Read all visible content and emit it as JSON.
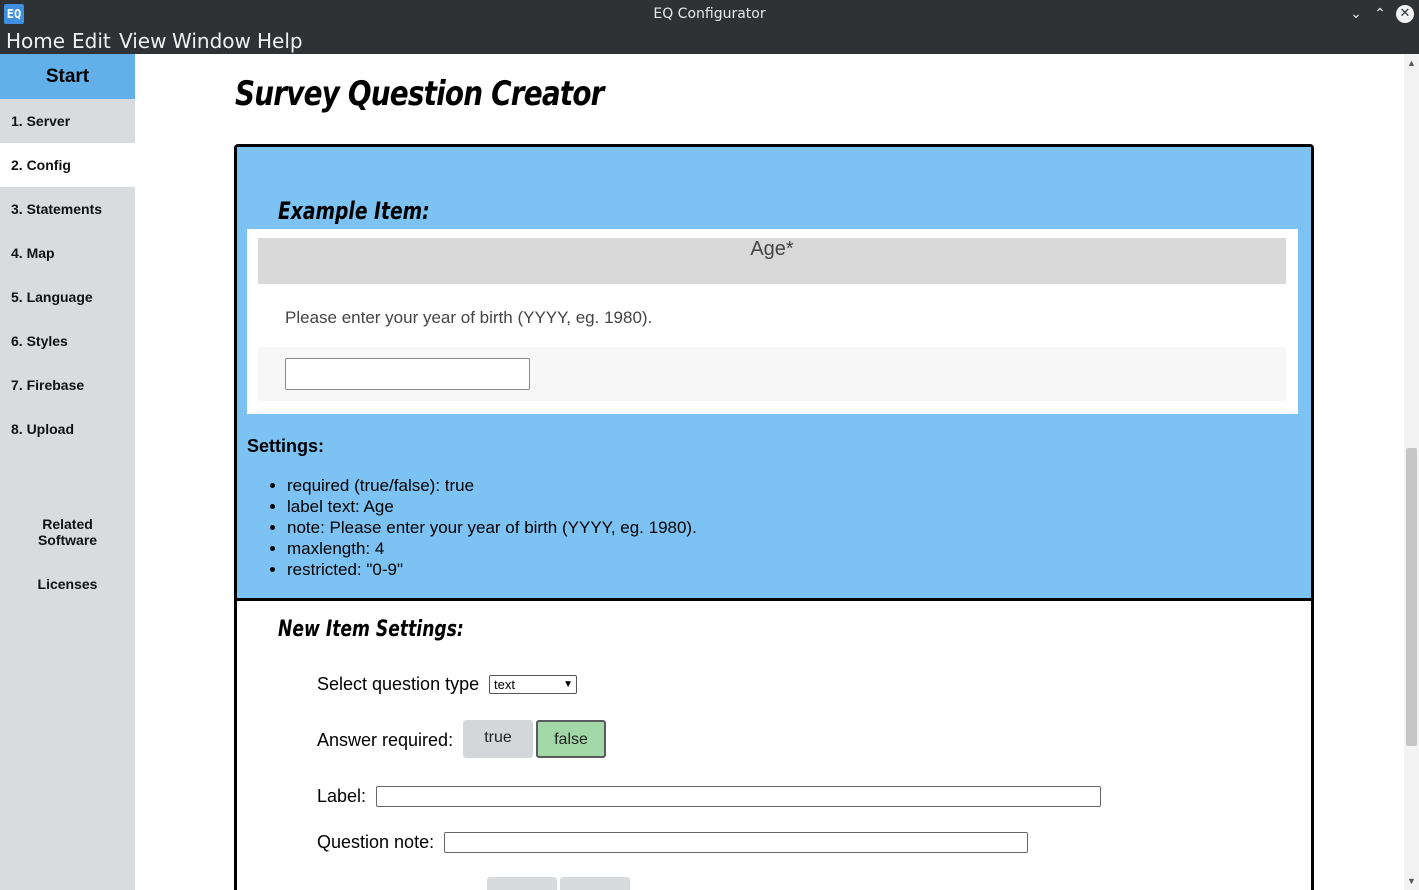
{
  "window": {
    "icon_text": "EQ",
    "title": "EQ Configurator",
    "minimize_glyph": "⌄",
    "maximize_glyph": "⌃",
    "close_glyph": "✕"
  },
  "menu": [
    "Home",
    "Edit",
    "View",
    "Window",
    "Help"
  ],
  "sidebar": {
    "start": "Start",
    "items": [
      {
        "label": "1. Server"
      },
      {
        "label": "2. Config"
      },
      {
        "label": "3. Statements"
      },
      {
        "label": "4. Map"
      },
      {
        "label": "5. Language"
      },
      {
        "label": "6. Styles"
      },
      {
        "label": "7. Firebase"
      },
      {
        "label": "8. Upload"
      }
    ],
    "active_index": 1,
    "related_line1": "Related",
    "related_line2": "Software",
    "licenses": "Licenses"
  },
  "main": {
    "title": "Survey Question Creator",
    "example": {
      "title": "Example Item:",
      "question_label": "Age*",
      "question_note": "Please enter your year of birth (YYYY, eg. 1980).",
      "input_value": ""
    },
    "settings": {
      "title": "Settings:",
      "items": [
        "required (true/false): true",
        "label text: Age",
        "note: Please enter your year of birth (YYYY, eg. 1980).",
        "maxlength: 4",
        "restricted: \"0-9\""
      ]
    },
    "new_item": {
      "title": "New Item Settings:",
      "question_type_label": "Select question type",
      "question_type_value": "text",
      "answer_required_label": "Answer required:",
      "true_label": "true",
      "false_label": "false",
      "selected": "false",
      "label_label": "Label:",
      "label_value": "",
      "note_label": "Question note:",
      "note_value": ""
    }
  },
  "colors": {
    "titlebar": "#2f3235",
    "accent_blue": "#62b0ea",
    "example_bg": "#7cc3f4",
    "selected_green": "#a2d8a7",
    "sidebar_bg": "#d8dcdf"
  }
}
